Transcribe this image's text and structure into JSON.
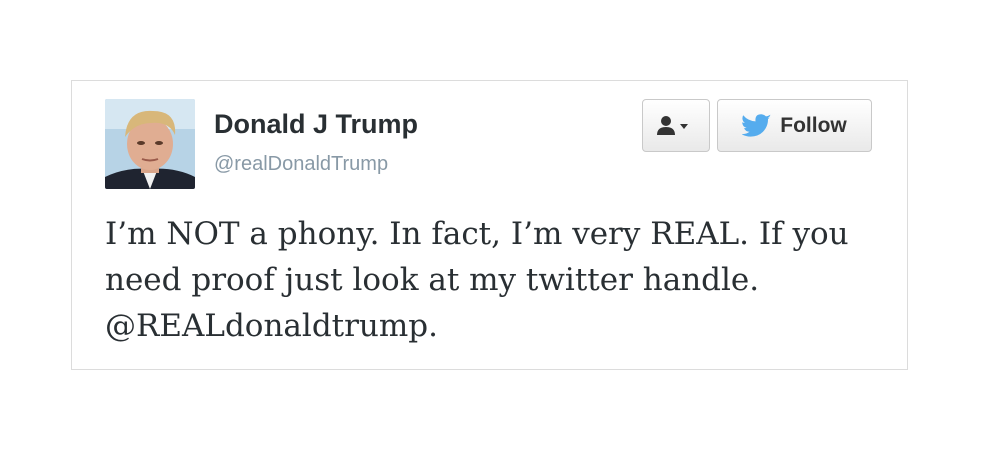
{
  "user": {
    "display_name": "Donald J Trump",
    "screen_name": "@realDonaldTrump"
  },
  "actions": {
    "follow_label": "Follow"
  },
  "tweet": {
    "text": "I’m NOT a phony. In fact, I’m very REAL. If you need proof just look at my twitter handle. @REALdonaldtrump."
  },
  "icons": {
    "user_actions": "person-dropdown-icon",
    "follow": "twitter-bird-icon"
  },
  "colors": {
    "twitter_blue": "#55acee",
    "text": "#292f33",
    "handle": "#8899a6"
  }
}
